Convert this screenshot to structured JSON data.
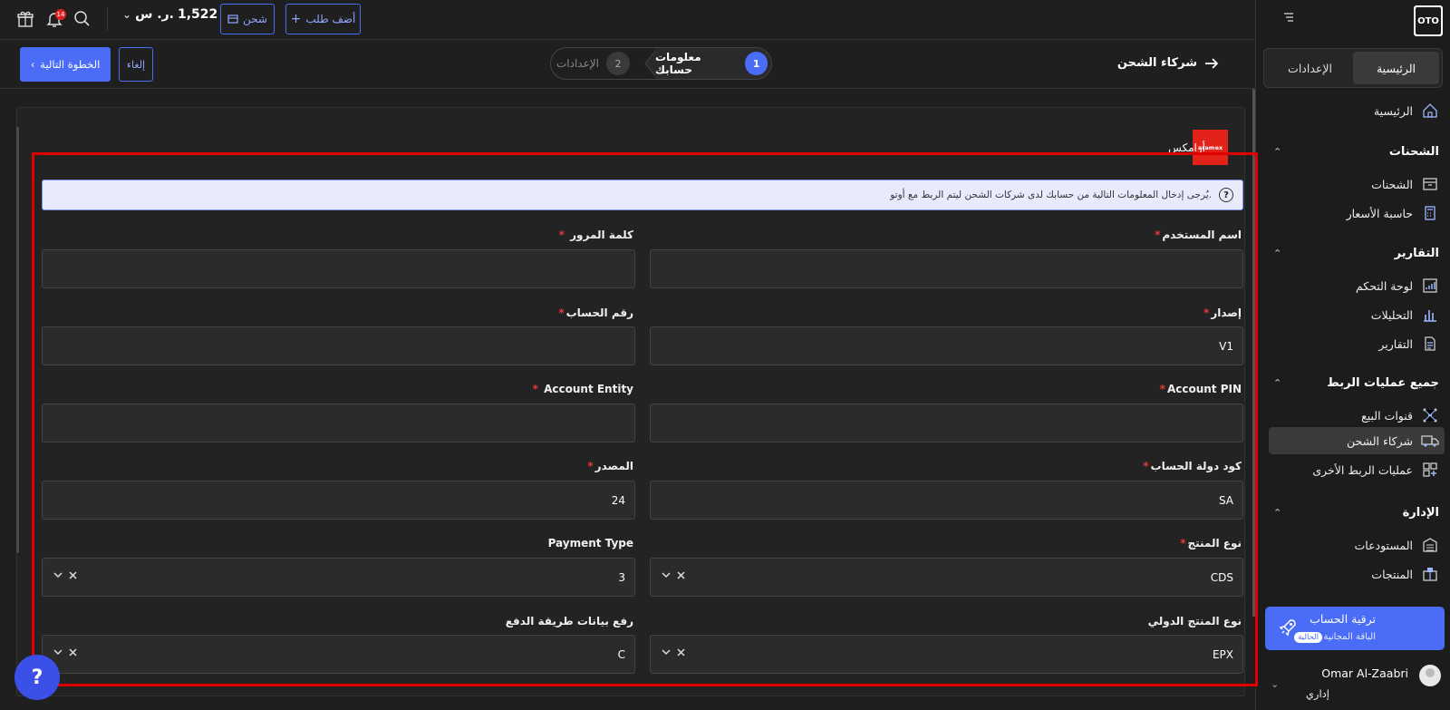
{
  "topbar": {
    "add_order_label": "أضف طلب",
    "ship_label": "شحن",
    "balance_value": "1,522",
    "balance_currency": "ر. س.",
    "notifications_count": "14"
  },
  "subbar": {
    "next_label": "الخطوة التالية",
    "cancel_label": "إلغاء",
    "step1_num": "1",
    "step1_label": "معلومات حسابك",
    "step2_num": "2",
    "step2_label": "الإعدادات",
    "page_title": "شركاء الشحن"
  },
  "sidebar": {
    "logo": "OTO",
    "tabs": [
      "الرئيسية",
      "الإعدادات"
    ],
    "home": "الرئيسية",
    "sections": {
      "shipments": "الشحنات",
      "reports": "التقارير",
      "integrations": "جميع عمليات الربط",
      "admin": "الإدارة"
    },
    "items": {
      "shipments": "الشحنات",
      "calculator": "حاسبة الأسعار",
      "dashboard": "لوحة التحكم",
      "analytics": "التحليلات",
      "reports": "التقارير",
      "sales_channels": "قنوات البيع",
      "shipping_partners": "شركاء الشحن",
      "other_integrations": "عمليات الربط الأخرى",
      "warehouses": "المستودعات",
      "products": "المنتجات"
    },
    "upgrade_title": "ترقية الحساب",
    "upgrade_plan": "الباقة المجانية",
    "upgrade_badge": "الحالية",
    "user_name": "Omar Al-Zaabri",
    "user_role": "إداري"
  },
  "carrier": {
    "logo_text": "aramex",
    "name": "أرامكس"
  },
  "notice": "يُرجى إدخال المعلومات التالية من حسابك لدى شركات الشحن ليتم الربط مع أوتو.",
  "form": {
    "username_label": "اسم المستخدم",
    "username_value": "",
    "password_label": "كلمة المرور",
    "password_value": "",
    "version_label": "إصدار",
    "version_value": "V1",
    "account_number_label": "رقم الحساب",
    "account_number_value": "",
    "account_pin_label": "Account PIN",
    "account_pin_value": "",
    "account_entity_label": "Account Entity",
    "account_entity_value": "",
    "country_code_label": "كود دولة الحساب",
    "country_code_value": "SA",
    "source_label": "المصدر",
    "source_value": "24",
    "product_type_label": "نوع المنتج",
    "product_type_value": "CDS",
    "payment_type_label": "Payment Type",
    "payment_type_value": "3",
    "intl_product_type_label": "نوع المنتج الدولي",
    "intl_product_type_value": "EPX",
    "payment_method_label": "رفع بيانات طريقة الدفع",
    "payment_method_value": "C"
  },
  "colors": {
    "accent": "#4a6cf7",
    "highlight_frame": "#e00000",
    "background": "#1f1f1f",
    "aramex_red": "#e32219"
  },
  "help_label": "?"
}
